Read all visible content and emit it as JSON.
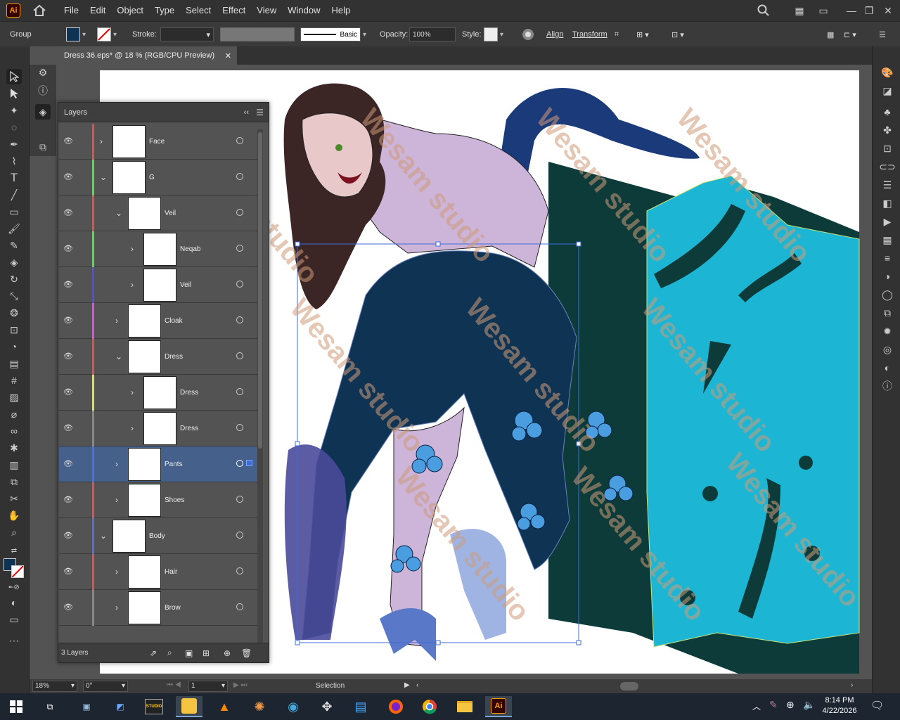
{
  "app": {
    "logo": "Ai",
    "accent": "#FF9A00"
  },
  "menu": [
    "File",
    "Edit",
    "Object",
    "Type",
    "Select",
    "Effect",
    "View",
    "Window",
    "Help"
  ],
  "control": {
    "selection_type": "Group",
    "fill_color": "#0f3352",
    "stroke_label": "Stroke:",
    "brush_label": "Basic",
    "opacity_label": "Opacity:",
    "opacity_value": "100%",
    "style_label": "Style:",
    "align_label": "Align",
    "transform_label": "Transform"
  },
  "document": {
    "tab_title": "Dress 36.eps* @ 18 % (RGB/CPU Preview)"
  },
  "layers_panel": {
    "title": "Layers",
    "count_label": "3 Layers",
    "rows": [
      {
        "name": "Face",
        "depth": 0,
        "color": "#e05050",
        "expanded": false,
        "selected": false
      },
      {
        "name": "G",
        "depth": 0,
        "color": "#50e050",
        "expanded": true,
        "selected": false
      },
      {
        "name": "Veil",
        "depth": 1,
        "color": "#e05050",
        "expanded": true,
        "selected": false
      },
      {
        "name": "Neqab",
        "depth": 2,
        "color": "#50e050",
        "expanded": false,
        "selected": false
      },
      {
        "name": "Veil",
        "depth": 2,
        "color": "#5050e0",
        "expanded": false,
        "selected": false
      },
      {
        "name": "Cloak",
        "depth": 1,
        "color": "#e050e0",
        "expanded": false,
        "selected": false
      },
      {
        "name": "Dress",
        "depth": 1,
        "color": "#e05050",
        "expanded": true,
        "selected": false
      },
      {
        "name": "Dress",
        "depth": 2,
        "color": "#e0e050",
        "expanded": false,
        "selected": false
      },
      {
        "name": "Dress",
        "depth": 2,
        "color": "#888888",
        "expanded": false,
        "selected": false
      },
      {
        "name": "Pants",
        "depth": 1,
        "color": "#5070e0",
        "expanded": false,
        "selected": true
      },
      {
        "name": "Shoes",
        "depth": 1,
        "color": "#e05050",
        "expanded": false,
        "selected": false
      },
      {
        "name": "Body",
        "depth": 0,
        "color": "#5070e0",
        "expanded": true,
        "selected": false
      },
      {
        "name": "Hair",
        "depth": 1,
        "color": "#e05050",
        "expanded": false,
        "selected": false
      },
      {
        "name": "Brow",
        "depth": 1,
        "color": "#888888",
        "expanded": false,
        "selected": false
      }
    ]
  },
  "status": {
    "zoom": "18%",
    "rotation": "0°",
    "artboard": "1",
    "tool": "Selection"
  },
  "watermark": "Wesam studio",
  "taskbar": {
    "time": "8:14 PM",
    "date": "4/22/2026",
    "studio_label": "STUDIO"
  }
}
